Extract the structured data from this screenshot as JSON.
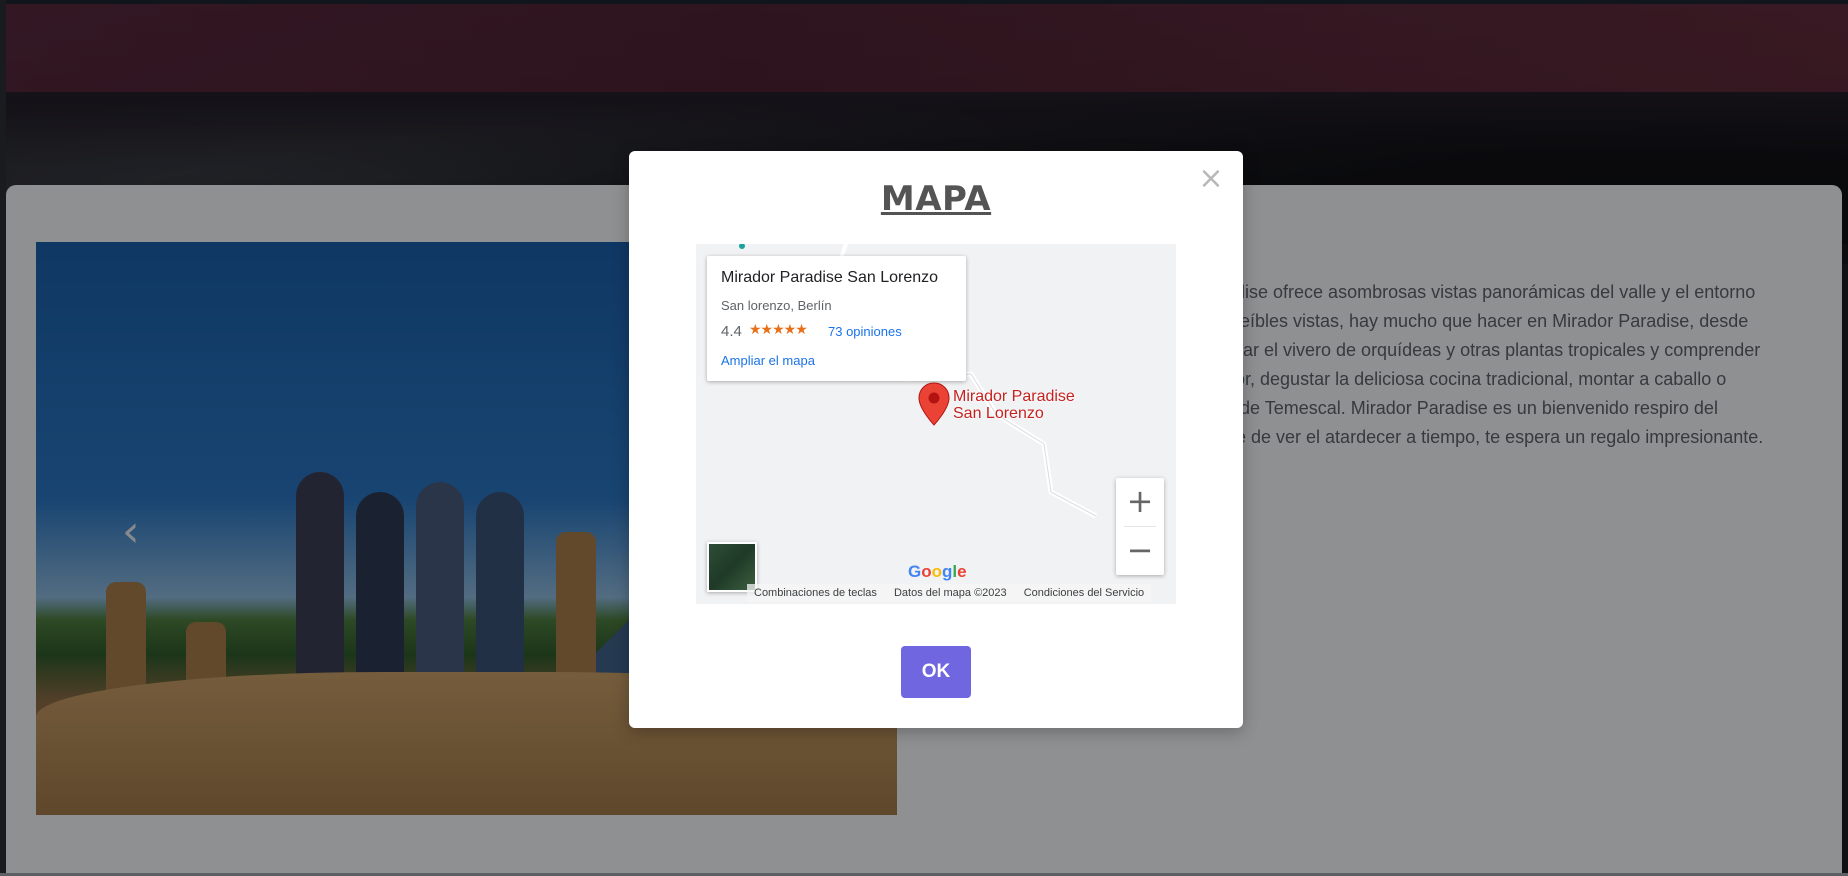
{
  "modal": {
    "title": "MAPA",
    "close_glyph": "×",
    "ok_label": "OK"
  },
  "map": {
    "place_name": "Mirador Paradise San Lorenzo",
    "address": "San lorenzo, Berlín",
    "rating": "4.4",
    "stars": "★★★★★",
    "reviews": "73 opiniones",
    "expand_link": "Ampliar el mapa",
    "pin_label_line1": "Mirador Paradise",
    "pin_label_line2": "San Lorenzo",
    "zoom_in": "+",
    "zoom_out": "−",
    "logo": "Google",
    "footer": {
      "shortcuts": "Combinaciones de teclas",
      "map_data": "Datos del mapa ©2023",
      "terms": "Condiciones del Servicio"
    }
  },
  "description": {
    "lines": [
      "adise ofrece asombrosas vistas panorámicas del valle y el entorno",
      "creíbles vistas, hay mucho que hacer en Mirador Paradise, desde",
      "sitar el vivero de orquídeas y otras plantas tropicales y comprender",
      "dor, degustar la deliciosa cocina tradicional, montar a caballo o",
      "o de Temescal. Mirador Paradise es un bienvenido respiro del",
      "rte de ver el atardecer a tiempo, te espera un regalo impresionante."
    ]
  },
  "carousel": {
    "prev_glyph": "‹"
  },
  "icons": {
    "close": "close-icon",
    "pin": "map-pin-icon",
    "prev": "chevron-left-icon"
  },
  "colors": {
    "ok_button": "#7066e0",
    "title": "#545454",
    "pin": "#ea4335",
    "link": "#1a73e8"
  }
}
